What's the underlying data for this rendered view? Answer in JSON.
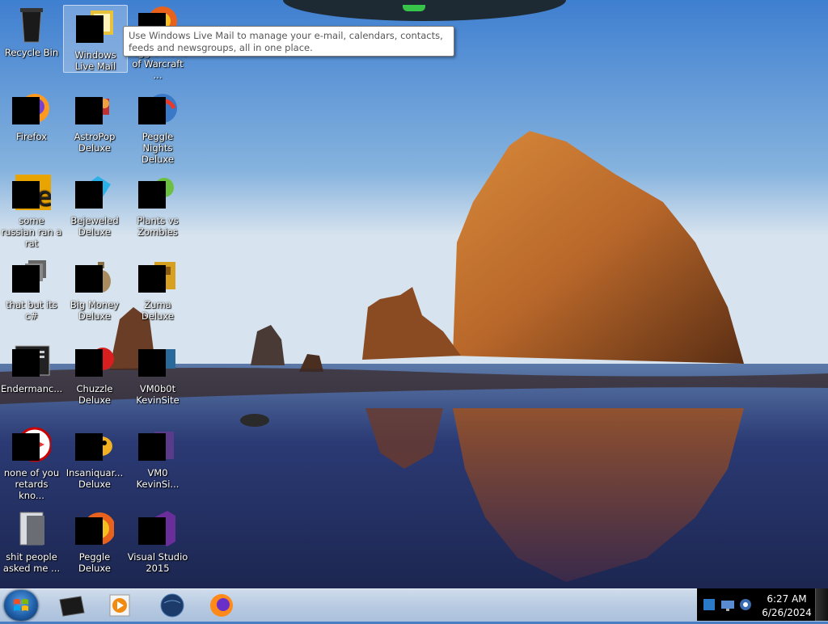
{
  "desktop": {
    "icons": [
      {
        "label": "Recycle Bin"
      },
      {
        "label": "Windows Live Mail"
      },
      {
        "label": "Peggle World of Warcraft ..."
      },
      {
        "label": "Firefox"
      },
      {
        "label": "AstroPop Deluxe"
      },
      {
        "label": "Peggle Nights Deluxe"
      },
      {
        "label": "some russian ran a rat"
      },
      {
        "label": "Bejeweled Deluxe"
      },
      {
        "label": "Plants vs Zombies"
      },
      {
        "label": "that but its c#"
      },
      {
        "label": "Big Money Deluxe"
      },
      {
        "label": "Zuma Deluxe"
      },
      {
        "label": "Endermanc..."
      },
      {
        "label": "Chuzzle Deluxe"
      },
      {
        "label": "VM0b0t KevinSite"
      },
      {
        "label": "none of you retards kno..."
      },
      {
        "label": "Insaniquar... Deluxe"
      },
      {
        "label": "VM0 KevinSi..."
      },
      {
        "label": "shit people asked me ..."
      },
      {
        "label": "Peggle Deluxe"
      },
      {
        "label": "Visual Studio 2015"
      }
    ]
  },
  "tooltip": {
    "text": "Use Windows Live Mail to manage your e-mail, calendars, contacts, feeds and newsgroups, all in one place."
  },
  "taskbar": {
    "pinned": [
      "terminal-icon",
      "media-player-icon",
      "globe-icon",
      "firefox-icon"
    ]
  },
  "tray": {
    "time": "6:27 AM",
    "date": "6/26/2024"
  },
  "colors": {
    "sky_top": "#3f7fd0",
    "sky_horizon": "#d7e3ee",
    "rock": "#b8672a",
    "water": "#2b3a74",
    "taskbar": "#b9cbe2"
  }
}
